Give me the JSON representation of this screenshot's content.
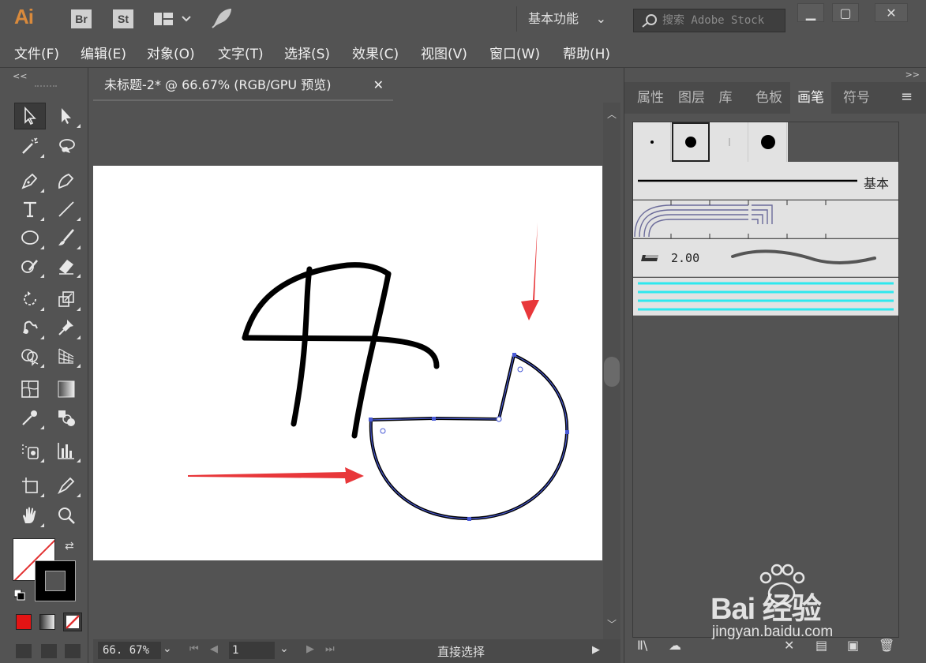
{
  "app": {
    "logo": "Ai",
    "bridge_label": "Br",
    "stock_label": "St",
    "workspace": "基本功能",
    "search_placeholder": "搜索 Adobe Stock"
  },
  "menu": [
    "文件(F)",
    "编辑(E)",
    "对象(O)",
    "文字(T)",
    "选择(S)",
    "效果(C)",
    "视图(V)",
    "窗口(W)",
    "帮助(H)"
  ],
  "document": {
    "tab_title": "未标题-2* @ 66.67% (RGB/GPU 预览)"
  },
  "status": {
    "zoom": "66. 67%",
    "page": "1",
    "tool_name": "直接选择"
  },
  "right_panel": {
    "tabs": [
      "属性",
      "图层",
      "库",
      "色板",
      "画笔",
      "符号"
    ],
    "active_tab": "画笔",
    "brush_basic_label": "基本",
    "brush_size_label": "2.00"
  },
  "watermark": {
    "brand": "Bai 经验",
    "url": "jingyan.baidu.com"
  },
  "colors": {
    "ui_bg": "#535353",
    "accent_red": "#e8373a",
    "path_blue": "#4a5bd6",
    "cyan_brush": "#2ee8ee"
  }
}
